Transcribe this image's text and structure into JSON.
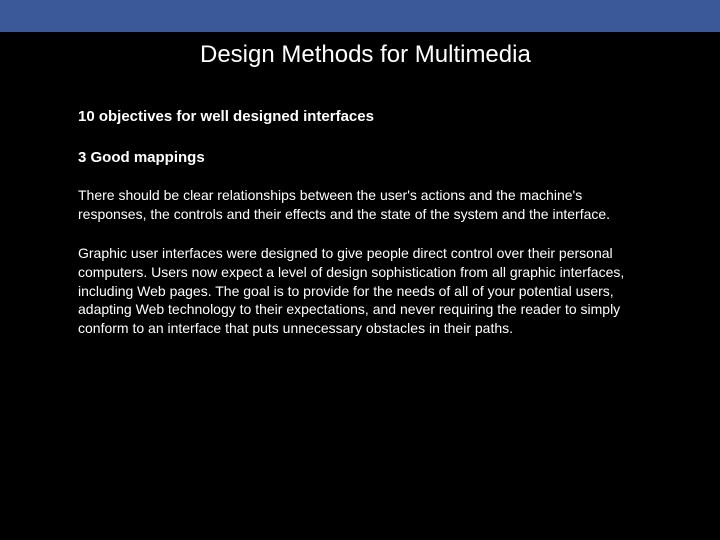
{
  "header": {
    "title": "Design Methods for Multimedia"
  },
  "content": {
    "section_title": "10 objectives for well designed interfaces",
    "subsection_title": "3 Good mappings",
    "paragraph1": "There should be clear relationships between the user's actions and the machine's responses, the controls and their effects and the state of the system and the interface.",
    "paragraph2": "Graphic user interfaces were designed to give people direct control over their personal computers. Users now expect a level of design sophistication from all graphic interfaces, including Web pages. The goal is to provide for the needs of all of your potential users, adapting Web technology to their expectations, and never requiring the reader to simply conform to an interface that puts unnecessary obstacles in their paths."
  }
}
